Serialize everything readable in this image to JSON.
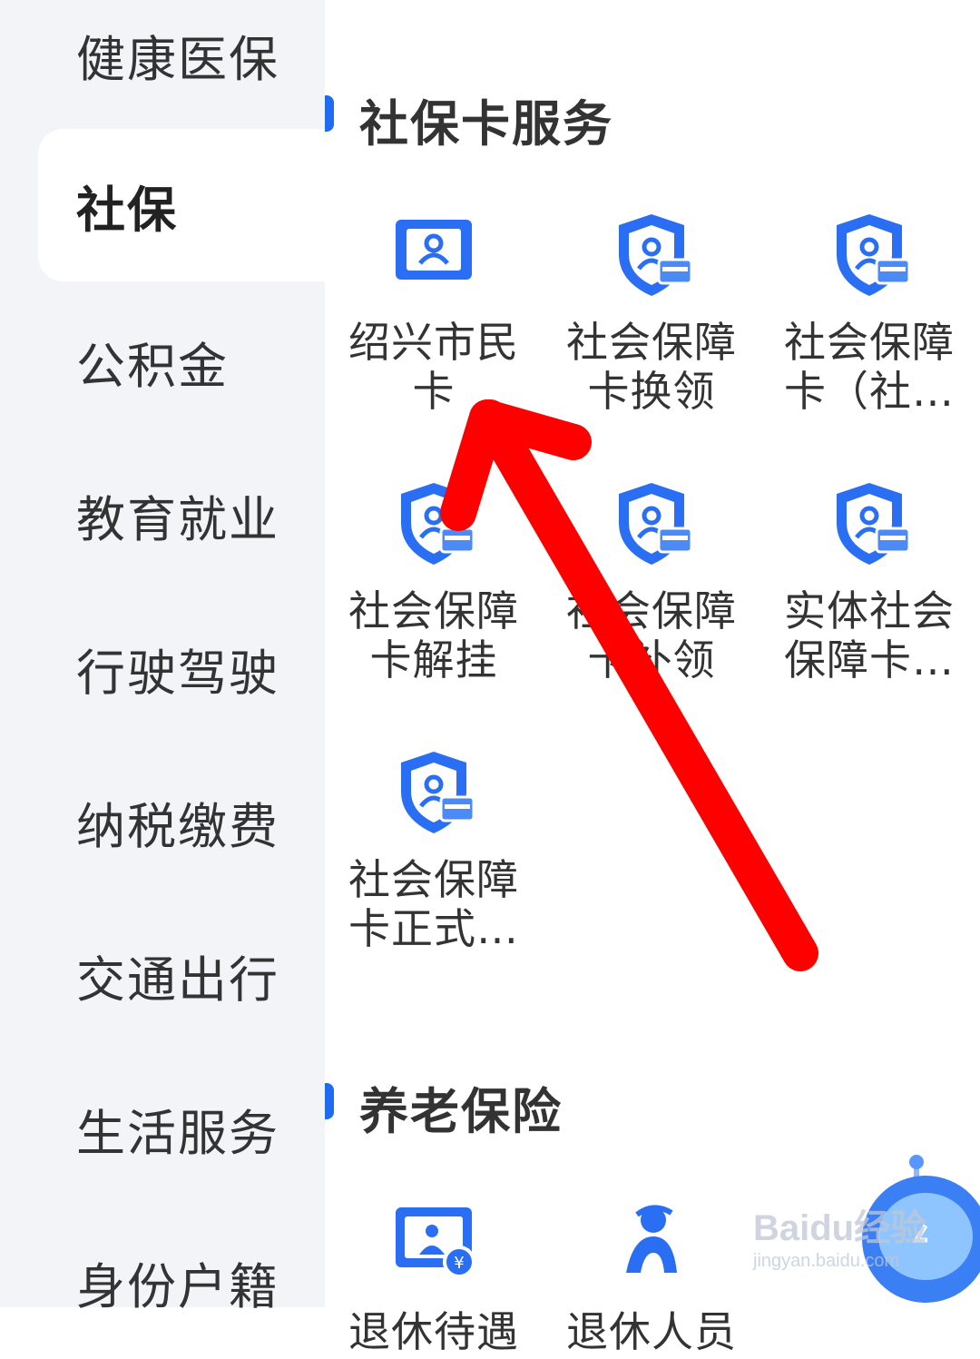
{
  "sidebar": {
    "items": [
      {
        "label": "健康医保"
      },
      {
        "label": "社保",
        "active": true
      },
      {
        "label": "公积金"
      },
      {
        "label": "教育就业"
      },
      {
        "label": "行驶驾驶"
      },
      {
        "label": "纳税缴费"
      },
      {
        "label": "交通出行"
      },
      {
        "label": "生活服务"
      },
      {
        "label": "身份户籍"
      }
    ]
  },
  "sections": [
    {
      "title": "社保卡服务",
      "items": [
        {
          "line1": "绍兴市民",
          "line2": "卡",
          "icon": "citizen-card-icon"
        },
        {
          "line1": "社会保障",
          "line2": "卡换领",
          "icon": "shield-card-icon"
        },
        {
          "line1": "社会保障",
          "line2": "卡（社…",
          "icon": "shield-card-icon"
        },
        {
          "line1": "社会保障",
          "line2": "卡解挂",
          "icon": "shield-card-icon"
        },
        {
          "line1": "社会保障",
          "line2": "卡补领",
          "icon": "shield-card-icon"
        },
        {
          "line1": "实体社会",
          "line2": "保障卡…",
          "icon": "shield-card-icon"
        },
        {
          "line1": "社会保障",
          "line2": "卡正式…",
          "icon": "shield-card-icon"
        }
      ]
    },
    {
      "title": "养老保险",
      "items": [
        {
          "line1": "退休待遇",
          "line2": "",
          "icon": "pension-payment-icon"
        },
        {
          "line1": "退休人员",
          "line2": "",
          "icon": "retiree-icon"
        }
      ]
    }
  ],
  "watermark": {
    "logo": "Baidu经验",
    "url": "jingyan.baidu.com"
  },
  "colors": {
    "accent": "#1e6cf2",
    "arrow": "#ff0000",
    "sidebar_bg": "#f3f4f8"
  }
}
